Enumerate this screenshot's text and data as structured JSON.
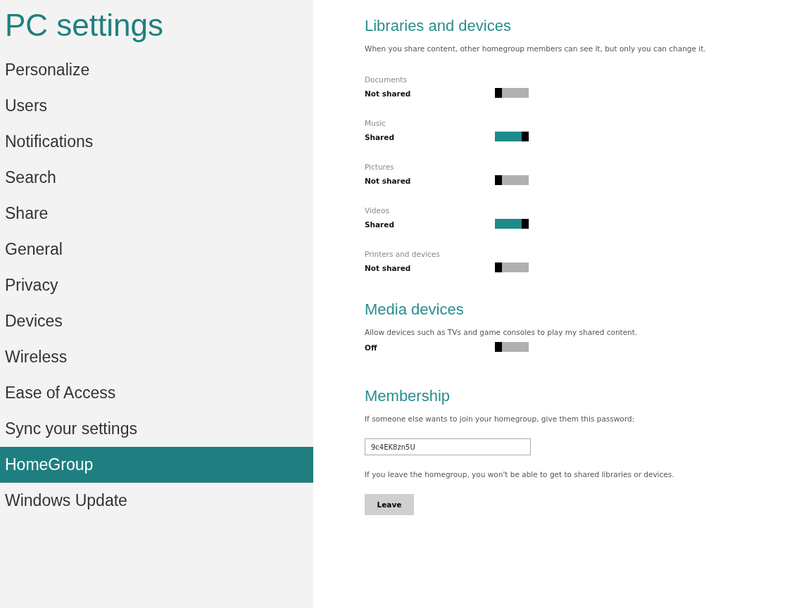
{
  "sidebar": {
    "title": "PC settings",
    "items": [
      {
        "label": "Personalize",
        "selected": false
      },
      {
        "label": "Users",
        "selected": false
      },
      {
        "label": "Notifications",
        "selected": false
      },
      {
        "label": "Search",
        "selected": false
      },
      {
        "label": "Share",
        "selected": false
      },
      {
        "label": "General",
        "selected": false
      },
      {
        "label": "Privacy",
        "selected": false
      },
      {
        "label": "Devices",
        "selected": false
      },
      {
        "label": "Wireless",
        "selected": false
      },
      {
        "label": "Ease of Access",
        "selected": false
      },
      {
        "label": "Sync your settings",
        "selected": false
      },
      {
        "label": "HomeGroup",
        "selected": true
      },
      {
        "label": "Windows Update",
        "selected": false
      }
    ]
  },
  "libraries": {
    "heading": "Libraries and devices",
    "description": "When you share content, other homegroup members can see it, but only you can change it.",
    "items": [
      {
        "label": "Documents",
        "status": "Not shared",
        "on": false
      },
      {
        "label": "Music",
        "status": "Shared",
        "on": true
      },
      {
        "label": "Pictures",
        "status": "Not shared",
        "on": false
      },
      {
        "label": "Videos",
        "status": "Shared",
        "on": true
      },
      {
        "label": "Printers and devices",
        "status": "Not shared",
        "on": false
      }
    ]
  },
  "media": {
    "heading": "Media devices",
    "description": "Allow devices such as TVs and game consoles to play my shared content.",
    "status": "Off",
    "on": false
  },
  "membership": {
    "heading": "Membership",
    "description": "If someone else wants to join your homegroup, give them this password:",
    "password": "9c4EK8zn5U",
    "note": "If you leave the homegroup, you won't be able to get to shared libraries or devices.",
    "button": "Leave"
  }
}
